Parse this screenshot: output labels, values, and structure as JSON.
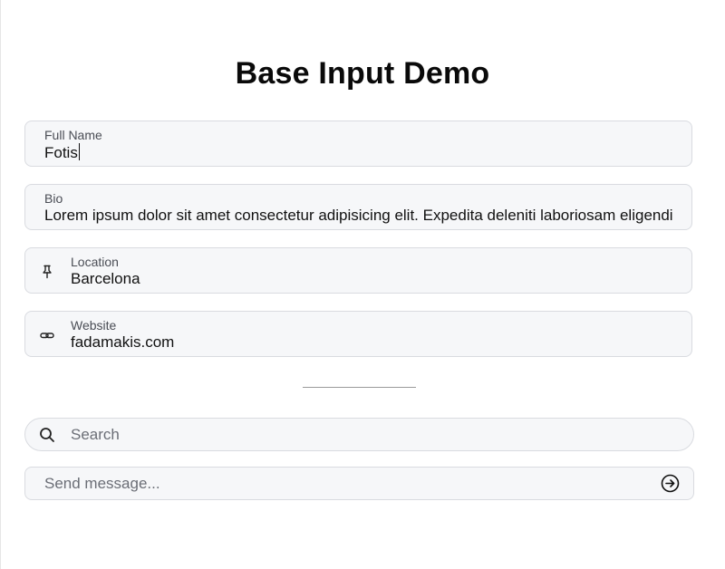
{
  "page": {
    "title": "Base Input Demo"
  },
  "fields": {
    "full_name": {
      "label": "Full Name",
      "value": "Fotis"
    },
    "bio": {
      "label": "Bio",
      "value": "Lorem ipsum dolor sit amet consectetur adipisicing elit. Expedita deleniti laboriosam eligendi"
    },
    "location": {
      "label": "Location",
      "value": "Barcelona",
      "icon": "pin-icon"
    },
    "website": {
      "label": "Website",
      "value": "fadamakis.com",
      "icon": "link-icon"
    }
  },
  "search": {
    "placeholder": "Search",
    "icon": "search-icon"
  },
  "message": {
    "placeholder": "Send message...",
    "icon": "arrow-right-circle-icon"
  }
}
